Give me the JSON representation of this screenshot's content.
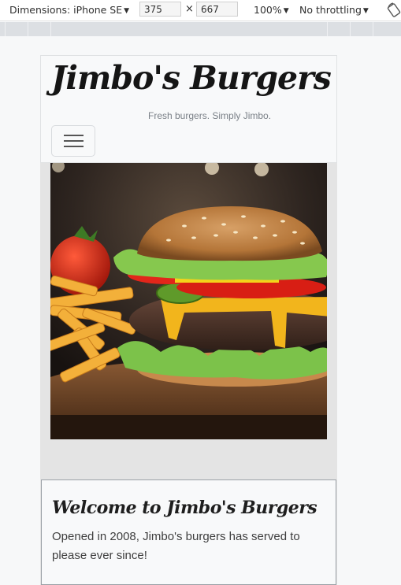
{
  "devtools": {
    "dimensions_label": "Dimensions: iPhone SE",
    "width_value": "375",
    "times": "×",
    "height_value": "667",
    "zoom_label": "100%",
    "throttling_label": "No throttling",
    "caret": "▼"
  },
  "site": {
    "brand": "Jimbo's Burgers",
    "tagline": "Fresh burgers. Simply Jimbo.",
    "menu_toggle_icon": "hamburger-icon",
    "hero_image": "burger-and-fries-photo"
  },
  "welcome": {
    "title": "Welcome to Jimbo's Burgers",
    "text": "Opened in 2008, Jimbo's burgers has served to please ever since!"
  },
  "colors": {
    "page_bg": "#f7f8f9",
    "header_bg": "#f8f9fa",
    "brand_text": "#151515",
    "tagline_text": "#7a8087"
  }
}
